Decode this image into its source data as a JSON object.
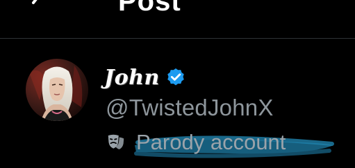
{
  "header": {
    "title": "Post",
    "back_icon": "arrow-left-icon"
  },
  "profile": {
    "display_name": "John",
    "verified_icon": "verified-badge-icon",
    "verified_color": "#1d9bf0",
    "handle": "@TwistedJohnX",
    "parody_icon": "theater-masks-icon",
    "parody_label": "Parody account",
    "highlight_color": "#1a6e93"
  }
}
